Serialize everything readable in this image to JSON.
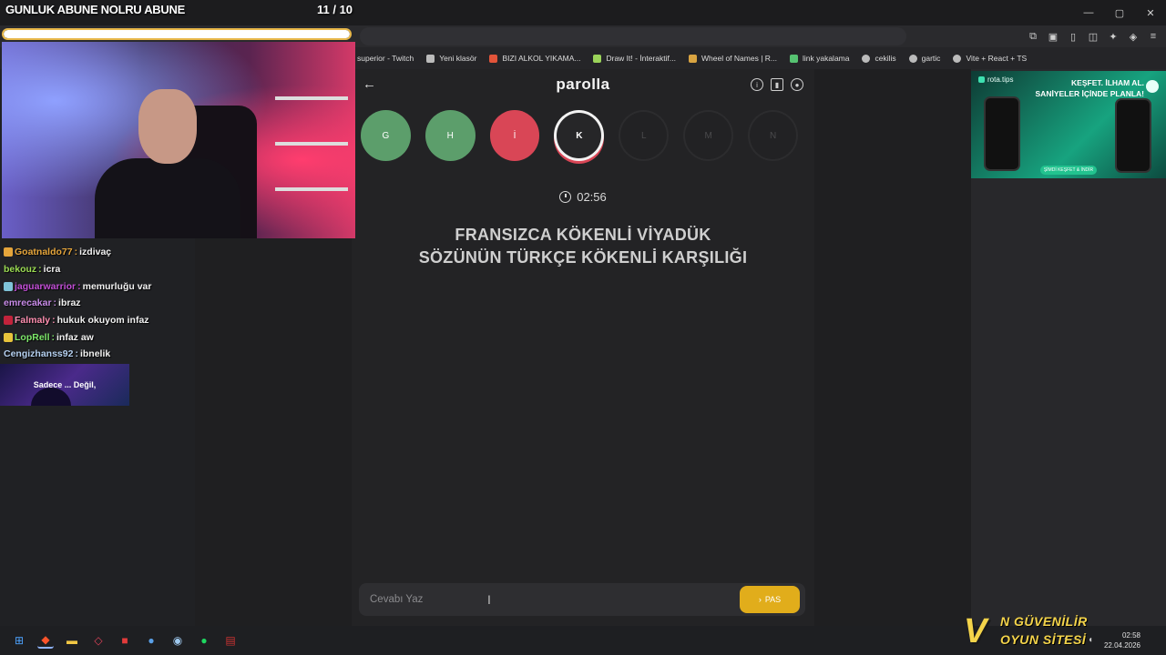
{
  "overlay": {
    "title": "GUNLUK ABUNE NOLRU ABUNE",
    "counter": "11 / 10",
    "progress": 1.0
  },
  "bookmarks": [
    {
      "label": "superior - Twitch",
      "icon": "none",
      "color": "#00000000"
    },
    {
      "label": "Yeni klasör",
      "icon": "folder-icon",
      "color": "#bbbbbb"
    },
    {
      "label": "BIZI ALKOL YIKAMA...",
      "icon": "site-icon",
      "color": "#e2543a"
    },
    {
      "label": "Draw It! - İnteraktif...",
      "icon": "site-icon",
      "color": "#9bd35a"
    },
    {
      "label": "Wheel of Names | R...",
      "icon": "site-icon",
      "color": "#d9a441"
    },
    {
      "label": "link yakalama",
      "icon": "play-icon",
      "color": "#56c271"
    },
    {
      "label": "cekilis",
      "icon": "globe-icon",
      "color": "#bbbbbb"
    },
    {
      "label": "gartic",
      "icon": "globe-icon",
      "color": "#bbbbbb"
    },
    {
      "label": "Vite + React + TS",
      "icon": "globe-icon",
      "color": "#bbbbbb"
    }
  ],
  "game": {
    "logo": "parolla",
    "letters": [
      {
        "char": "G",
        "state": "correct"
      },
      {
        "char": "H",
        "state": "correct"
      },
      {
        "char": "İ",
        "state": "wrong"
      },
      {
        "char": "K",
        "state": "active"
      },
      {
        "char": "L",
        "state": "pending"
      },
      {
        "char": "M",
        "state": "pending"
      },
      {
        "char": "N",
        "state": "pending"
      }
    ],
    "timer": "02:56",
    "question_line1": "FRANSIZCA KÖKENLİ VİYADÜK",
    "question_line2": "SÖZÜNÜN TÜRKÇE KÖKENLİ KARŞILIĞI",
    "answer_placeholder": "Cevabı Yaz",
    "pass_label": "PAS"
  },
  "chat": [
    {
      "user": "Goatnaldo77",
      "msg": "izdivaç",
      "color": "#e5a53b",
      "badge": "#e5a53b"
    },
    {
      "user": "bekouz",
      "msg": "icra",
      "color": "#9bdc53",
      "badge": ""
    },
    {
      "user": "jaguarwarrior",
      "msg": "memurluğu var",
      "color": "#c24ed6",
      "badge": "#7fc4d9"
    },
    {
      "user": "emrecakar",
      "msg": "ibraz",
      "color": "#c88be8",
      "badge": ""
    },
    {
      "user": "Falmaly",
      "msg": "hukuk okuyom infaz",
      "color": "#ff8fb0",
      "badge": "#c2233b"
    },
    {
      "user": "LopRell",
      "msg": "infaz aw",
      "color": "#7de86a",
      "badge": "#e8c43b"
    },
    {
      "user": "Cengizhanss92",
      "msg": "ibnelik",
      "color": "#b5d0f0",
      "badge": ""
    }
  ],
  "promo": {
    "text": "Sadece ... Değil,"
  },
  "ad": {
    "brand": "rota.tips",
    "headline": "KEŞFET. İLHAM AL. SANİYELER İÇİNDE PLANLA!",
    "cta": "ŞİMDİ KEŞFET & İNDİR"
  },
  "sponsor": {
    "letter": "V",
    "line1": "N GÜVENİLİR",
    "line2": "OYUN SİTESİ"
  },
  "taskbar": {
    "time": "02:58",
    "date": "22.04.2026"
  },
  "colors": {
    "correct": "#5c9e6b",
    "wrong": "#d94656",
    "pass": "#e1ad1b"
  }
}
